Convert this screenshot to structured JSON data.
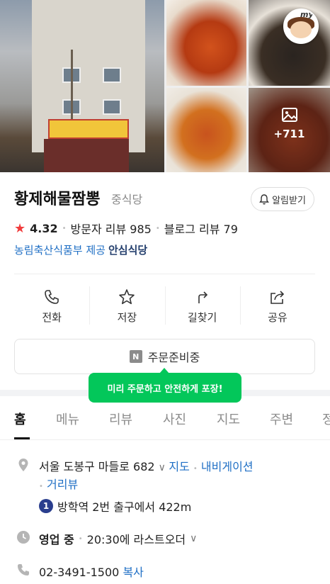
{
  "photos": {
    "more_count": "+711",
    "badge": "my"
  },
  "place": {
    "name": "황제해물짬뽕",
    "category": "중식당",
    "alarm_label": "알림받기",
    "rating": "4.32",
    "visitor_review": "방문자 리뷰 985",
    "blog_review": "블로그 리뷰 79",
    "cert_provider": "농림축산식품부 제공",
    "cert_name": "안심식당"
  },
  "actions": [
    {
      "label": "전화",
      "icon": "phone-icon"
    },
    {
      "label": "저장",
      "icon": "star-icon"
    },
    {
      "label": "길찾기",
      "icon": "directions-icon"
    },
    {
      "label": "공유",
      "icon": "share-icon"
    }
  ],
  "order": {
    "badge": "N",
    "label": "주문준비중",
    "tooltip": "미리 주문하고 안전하게 포장!"
  },
  "tabs": [
    "홈",
    "메뉴",
    "리뷰",
    "사진",
    "지도",
    "주변",
    "정"
  ],
  "info": {
    "address": "서울 도봉구 마들로 682",
    "map_link": "지도",
    "navi_link": "내비게이션",
    "street_view": "거리뷰",
    "subway_num": "1",
    "subway_text": "방학역 2번 출구에서 422m",
    "status": "영업 중",
    "hours_text": "20:30에 라스트오더",
    "phone": "02-3491-1500",
    "copy_label": "복사"
  },
  "colors": {
    "accent_green": "#03c75a",
    "link_blue": "#1f6fc5",
    "star_red": "#f13c3c"
  }
}
